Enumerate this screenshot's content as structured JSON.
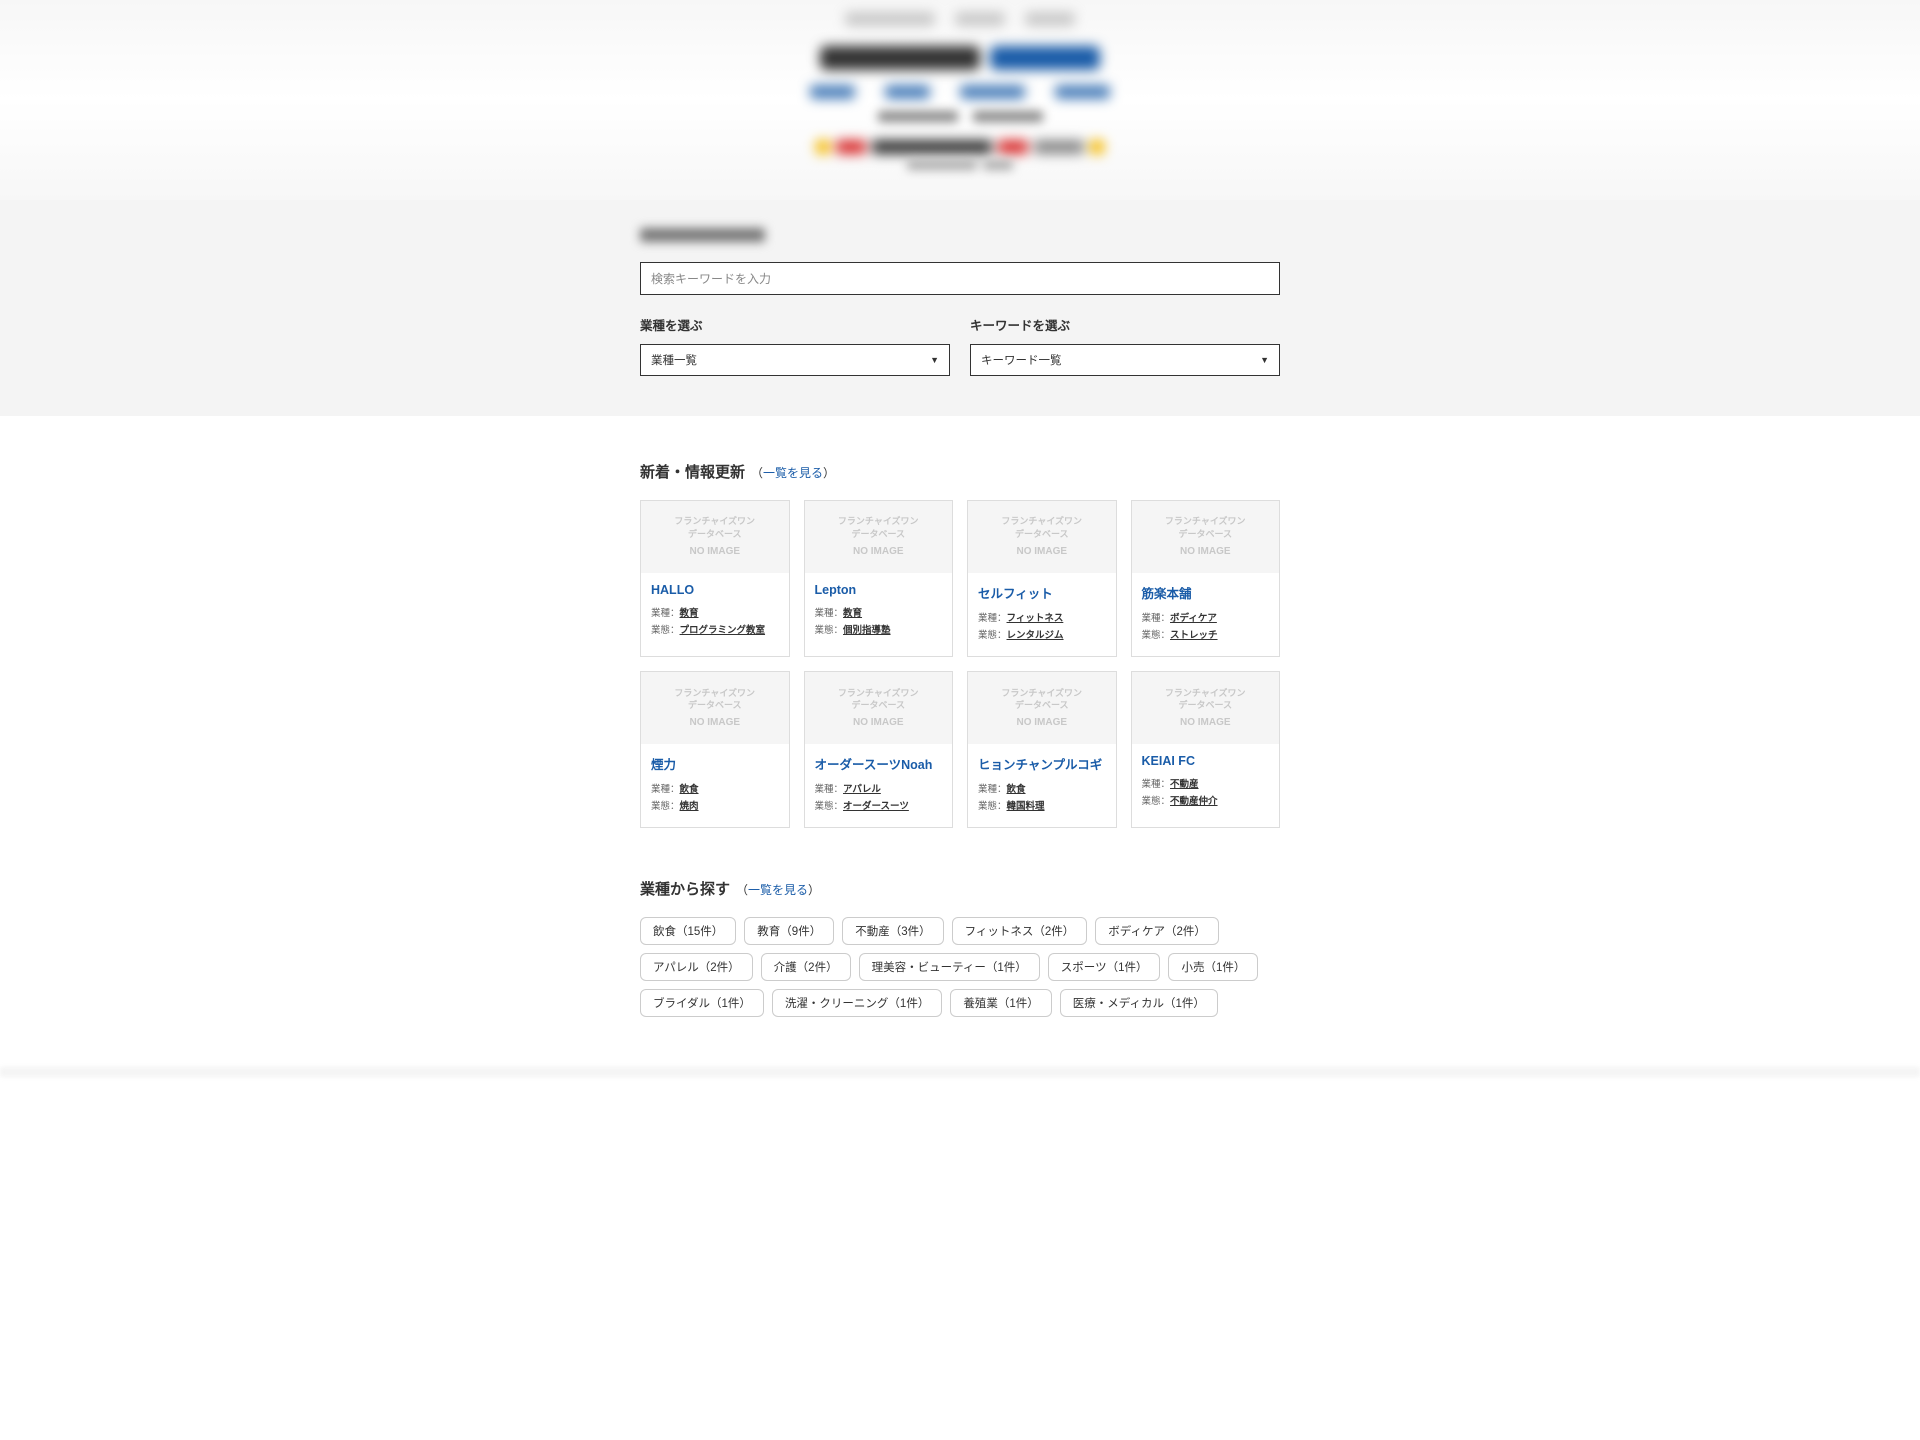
{
  "search": {
    "placeholder": "検索キーワードを入力",
    "industry_label": "業種を選ぶ",
    "industry_select": "業種一覧",
    "keyword_label": "キーワードを選ぶ",
    "keyword_select": "キーワード一覧"
  },
  "new_section": {
    "title": "新着・情報更新",
    "link_open": "（",
    "link_text": "一覧を見る",
    "link_close": "）"
  },
  "noimage": {
    "line1": "フランチャイズワン",
    "line2": "データベース",
    "line3": "NO IMAGE"
  },
  "cards": [
    {
      "title": "HALLO",
      "type_label": "業種：",
      "type": "教育",
      "cat_label": "業態：",
      "cat": "プログラミング教室"
    },
    {
      "title": "Lepton",
      "type_label": "業種：",
      "type": "教育",
      "cat_label": "業態：",
      "cat": "個別指導塾"
    },
    {
      "title": "セルフィット",
      "type_label": "業種：",
      "type": "フィットネス",
      "cat_label": "業態：",
      "cat": "レンタルジム"
    },
    {
      "title": "筋楽本舗",
      "type_label": "業種：",
      "type": "ボディケア",
      "cat_label": "業態：",
      "cat": "ストレッチ"
    },
    {
      "title": "煙力",
      "type_label": "業種：",
      "type": "飲食",
      "cat_label": "業態：",
      "cat": "焼肉"
    },
    {
      "title": "オーダースーツNoah",
      "type_label": "業種：",
      "type": "アパレル",
      "cat_label": "業態：",
      "cat": "オーダースーツ"
    },
    {
      "title": "ヒョンチャンプルコギ",
      "type_label": "業種：",
      "type": "飲食",
      "cat_label": "業態：",
      "cat": "韓国料理"
    },
    {
      "title": "KEIAI FC",
      "type_label": "業種：",
      "type": "不動産",
      "cat_label": "業態：",
      "cat": "不動産仲介"
    }
  ],
  "industry_section": {
    "title": "業種から探す",
    "link_open": "（",
    "link_text": "一覧を見る",
    "link_close": "）"
  },
  "tags": [
    "飲食（15件）",
    "教育（9件）",
    "不動産（3件）",
    "フィットネス（2件）",
    "ボディケア（2件）",
    "アパレル（2件）",
    "介護（2件）",
    "理美容・ビューティー（1件）",
    "スポーツ（1件）",
    "小売（1件）",
    "ブライダル（1件）",
    "洗濯・クリーニング（1件）",
    "養殖業（1件）",
    "医療・メディカル（1件）"
  ]
}
